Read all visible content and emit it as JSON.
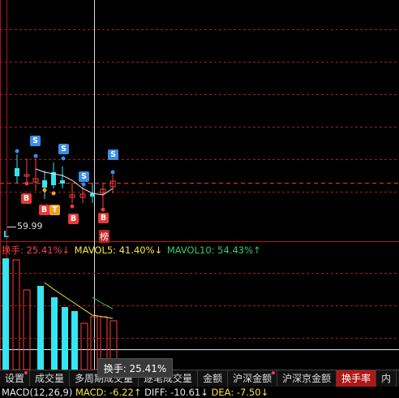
{
  "colors": {
    "bg": "#000000",
    "up": "#ff4040",
    "down": "#33e6f0",
    "grid": "#b01818",
    "ma_yellow": "#f5e642",
    "ma_green": "#33cc66",
    "ma_white": "#e8e8e8"
  },
  "price_panel": {
    "low_label": "59.99",
    "cursor_label": "L",
    "markers": [
      {
        "text": "S",
        "kind": "sell"
      },
      {
        "text": "S",
        "kind": "sell"
      },
      {
        "text": "S",
        "kind": "sell"
      },
      {
        "text": "S",
        "kind": "sell"
      },
      {
        "text": "S",
        "kind": "sell"
      },
      {
        "text": "B",
        "kind": "buy"
      },
      {
        "text": "B",
        "kind": "buy"
      },
      {
        "text": "T",
        "kind": "t"
      },
      {
        "text": "B",
        "kind": "buy"
      },
      {
        "text": "B",
        "kind": "buy"
      }
    ],
    "rank_badge": "榜"
  },
  "volume_panel": {
    "legend": [
      {
        "label": "换手: 25.41%↓",
        "color": "red"
      },
      {
        "label": "MAVOL5: 41.40%↓",
        "color": "yellow"
      },
      {
        "label": "MAVOL10: 54.43%↑",
        "color": "green"
      }
    ],
    "tooltip": "换手: 25.41%"
  },
  "tabs": [
    {
      "label": "设置",
      "flag": true,
      "active": false
    },
    {
      "label": "成交量",
      "flag": false,
      "active": false
    },
    {
      "label": "多周期成交量",
      "flag": false,
      "active": false
    },
    {
      "label": "逐笔成交量",
      "flag": false,
      "active": false
    },
    {
      "label": "金额",
      "flag": false,
      "active": false
    },
    {
      "label": "沪深金额",
      "flag": true,
      "active": false
    },
    {
      "label": "沪深京金额",
      "flag": false,
      "active": false
    },
    {
      "label": "换手率",
      "flag": false,
      "active": true
    },
    {
      "label": "内",
      "flag": false,
      "active": false
    }
  ],
  "macd_bar": [
    {
      "label": "MACD(12,26,9)",
      "color": "white"
    },
    {
      "label": "MACD: -6.22↑",
      "color": "yellow"
    },
    {
      "label": "DIFF: -10.61↓",
      "color": "white"
    },
    {
      "label": "DEA: -7.50↓",
      "color": "yellow"
    }
  ]
}
